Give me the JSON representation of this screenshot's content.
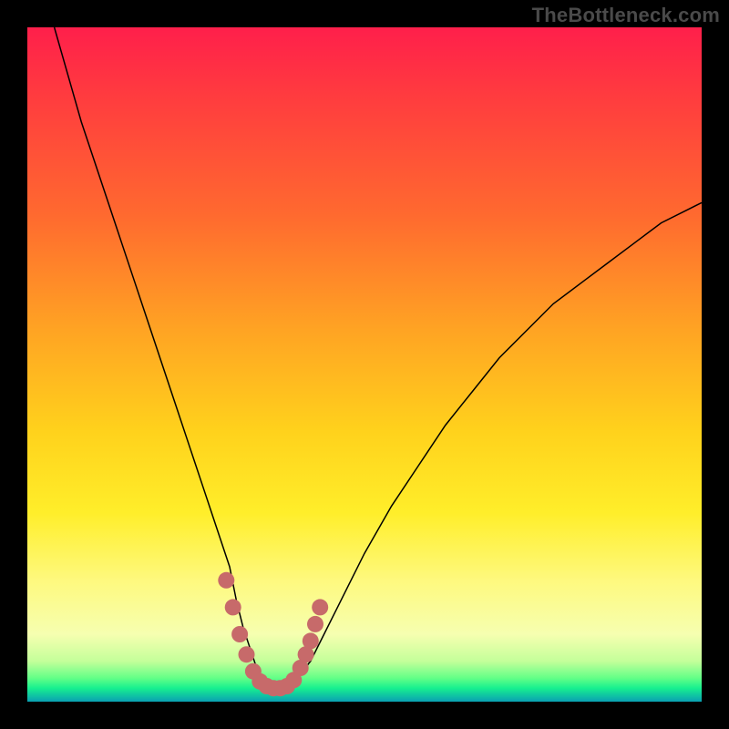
{
  "watermark": "TheBottleneck.com",
  "chart_data": {
    "type": "line",
    "title": "",
    "xlabel": "",
    "ylabel": "",
    "xlim": [
      0,
      100
    ],
    "ylim": [
      0,
      100
    ],
    "grid": false,
    "background": "rainbow-vertical",
    "series": [
      {
        "name": "bottleneck-curve",
        "x": [
          4,
          6,
          8,
          10,
          12,
          14,
          16,
          18,
          20,
          22,
          24,
          26,
          28,
          30,
          31,
          32,
          33,
          34,
          35,
          36,
          37,
          38,
          39,
          40,
          42,
          44,
          46,
          48,
          50,
          54,
          58,
          62,
          66,
          70,
          74,
          78,
          82,
          86,
          90,
          94,
          98,
          100
        ],
        "values": [
          100,
          93,
          86,
          80,
          74,
          68,
          62,
          56,
          50,
          44,
          38,
          32,
          26,
          20,
          15,
          11,
          8,
          5,
          3,
          2,
          2,
          2,
          2.5,
          3.5,
          6,
          10,
          14,
          18,
          22,
          29,
          35,
          41,
          46,
          51,
          55,
          59,
          62,
          65,
          68,
          71,
          73,
          74
        ]
      }
    ],
    "markers": {
      "name": "highlight-dots",
      "color": "#c76a6a",
      "points": [
        {
          "x": 29.5,
          "y": 18
        },
        {
          "x": 30.5,
          "y": 14
        },
        {
          "x": 31.5,
          "y": 10
        },
        {
          "x": 32.5,
          "y": 7
        },
        {
          "x": 33.5,
          "y": 4.5
        },
        {
          "x": 34.5,
          "y": 3
        },
        {
          "x": 35.5,
          "y": 2.3
        },
        {
          "x": 36.5,
          "y": 2
        },
        {
          "x": 37.5,
          "y": 2
        },
        {
          "x": 38.5,
          "y": 2.3
        },
        {
          "x": 39.5,
          "y": 3.2
        },
        {
          "x": 40.5,
          "y": 5
        },
        {
          "x": 41.3,
          "y": 7
        },
        {
          "x": 42,
          "y": 9
        },
        {
          "x": 42.7,
          "y": 11.5
        },
        {
          "x": 43.4,
          "y": 14
        }
      ]
    }
  }
}
